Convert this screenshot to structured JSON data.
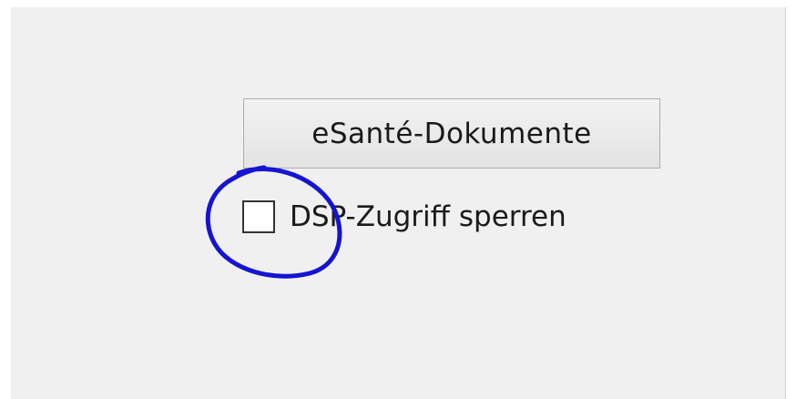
{
  "panel": {
    "button_label": "eSanté-Dokumente",
    "checkbox": {
      "label": "DSP-Zugriff sperren",
      "checked": false
    }
  },
  "annotation": {
    "color": "#1414d2",
    "shape": "hand-drawn-circle"
  }
}
